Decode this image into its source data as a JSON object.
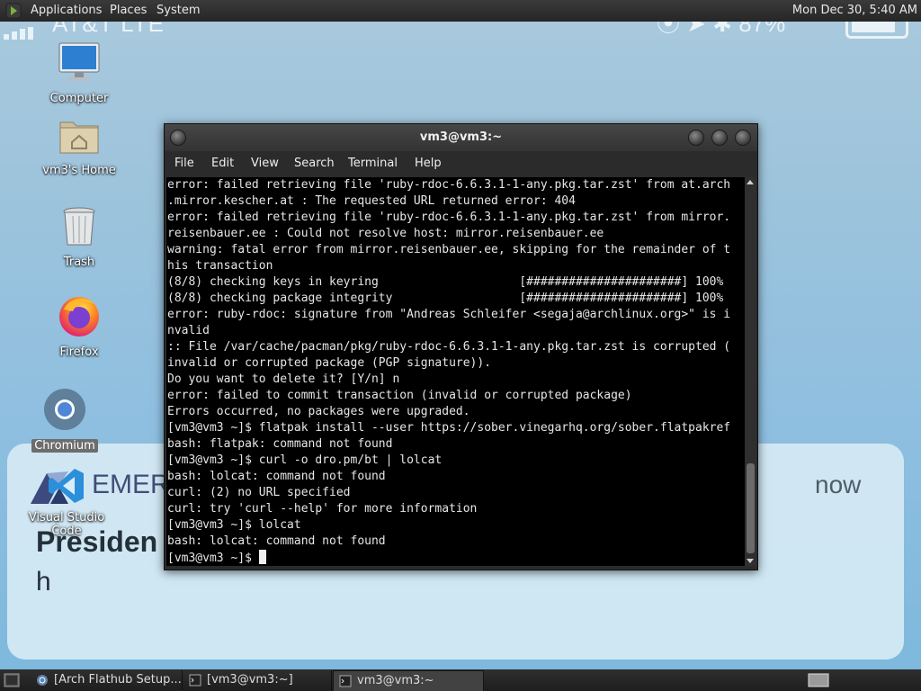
{
  "top_panel": {
    "menus": [
      "Applications",
      "Places",
      "System"
    ],
    "clock": "Mon Dec 30,  5:40 AM"
  },
  "wallpaper": {
    "carrier": "AT&T  LTE",
    "status_right": "⦿ ➤ ✱  87%",
    "notification": {
      "app": "EMER",
      "time": "now",
      "headline": "Presiden",
      "line2": "h"
    }
  },
  "desktop_icons": [
    {
      "label": "Computer",
      "icon": "computer-icon"
    },
    {
      "label": "vm3's Home",
      "icon": "home-folder-icon"
    },
    {
      "label": "Trash",
      "icon": "trash-icon"
    },
    {
      "label": "Firefox",
      "icon": "firefox-icon"
    },
    {
      "label": "Chromium",
      "icon": "chromium-icon"
    },
    {
      "label": "Visual Studio Code",
      "icon": "vscode-icon"
    }
  ],
  "terminal": {
    "title": "vm3@vm3:~",
    "menu": [
      "File",
      "Edit",
      "View",
      "Search",
      "Terminal",
      "Help"
    ],
    "lines": [
      "error: failed retrieving file 'ruby-rdoc-6.6.3.1-1-any.pkg.tar.zst' from at.arch",
      ".mirror.kescher.at : The requested URL returned error: 404",
      "error: failed retrieving file 'ruby-rdoc-6.6.3.1-1-any.pkg.tar.zst' from mirror.",
      "reisenbauer.ee : Could not resolve host: mirror.reisenbauer.ee",
      "warning: fatal error from mirror.reisenbauer.ee, skipping for the remainder of t",
      "his transaction",
      "(8/8) checking keys in keyring                    [######################] 100%",
      "(8/8) checking package integrity                  [######################] 100%",
      "error: ruby-rdoc: signature from \"Andreas Schleifer <segaja@archlinux.org>\" is i",
      "nvalid",
      ":: File /var/cache/pacman/pkg/ruby-rdoc-6.6.3.1-1-any.pkg.tar.zst is corrupted (",
      "invalid or corrupted package (PGP signature)).",
      "Do you want to delete it? [Y/n] n",
      "error: failed to commit transaction (invalid or corrupted package)",
      "Errors occurred, no packages were upgraded.",
      "[vm3@vm3 ~]$ flatpak install --user https://sober.vinegarhq.org/sober.flatpakref",
      "bash: flatpak: command not found",
      "[vm3@vm3 ~]$ curl -o dro.pm/bt | lolcat",
      "bash: lolcat: command not found",
      "curl: (2) no URL specified",
      "curl: try 'curl --help' for more information",
      "[vm3@vm3 ~]$ lolcat",
      "bash: lolcat: command not found"
    ],
    "prompt": "[vm3@vm3 ~]$ "
  },
  "taskbar": {
    "tasks": [
      {
        "label": "[Arch Flathub Setup...",
        "icon": "browser-icon",
        "active": false
      },
      {
        "label": "[vm3@vm3:~]",
        "icon": "terminal-icon",
        "active": false
      },
      {
        "label": "vm3@vm3:~",
        "icon": "terminal-icon",
        "active": true
      }
    ]
  }
}
